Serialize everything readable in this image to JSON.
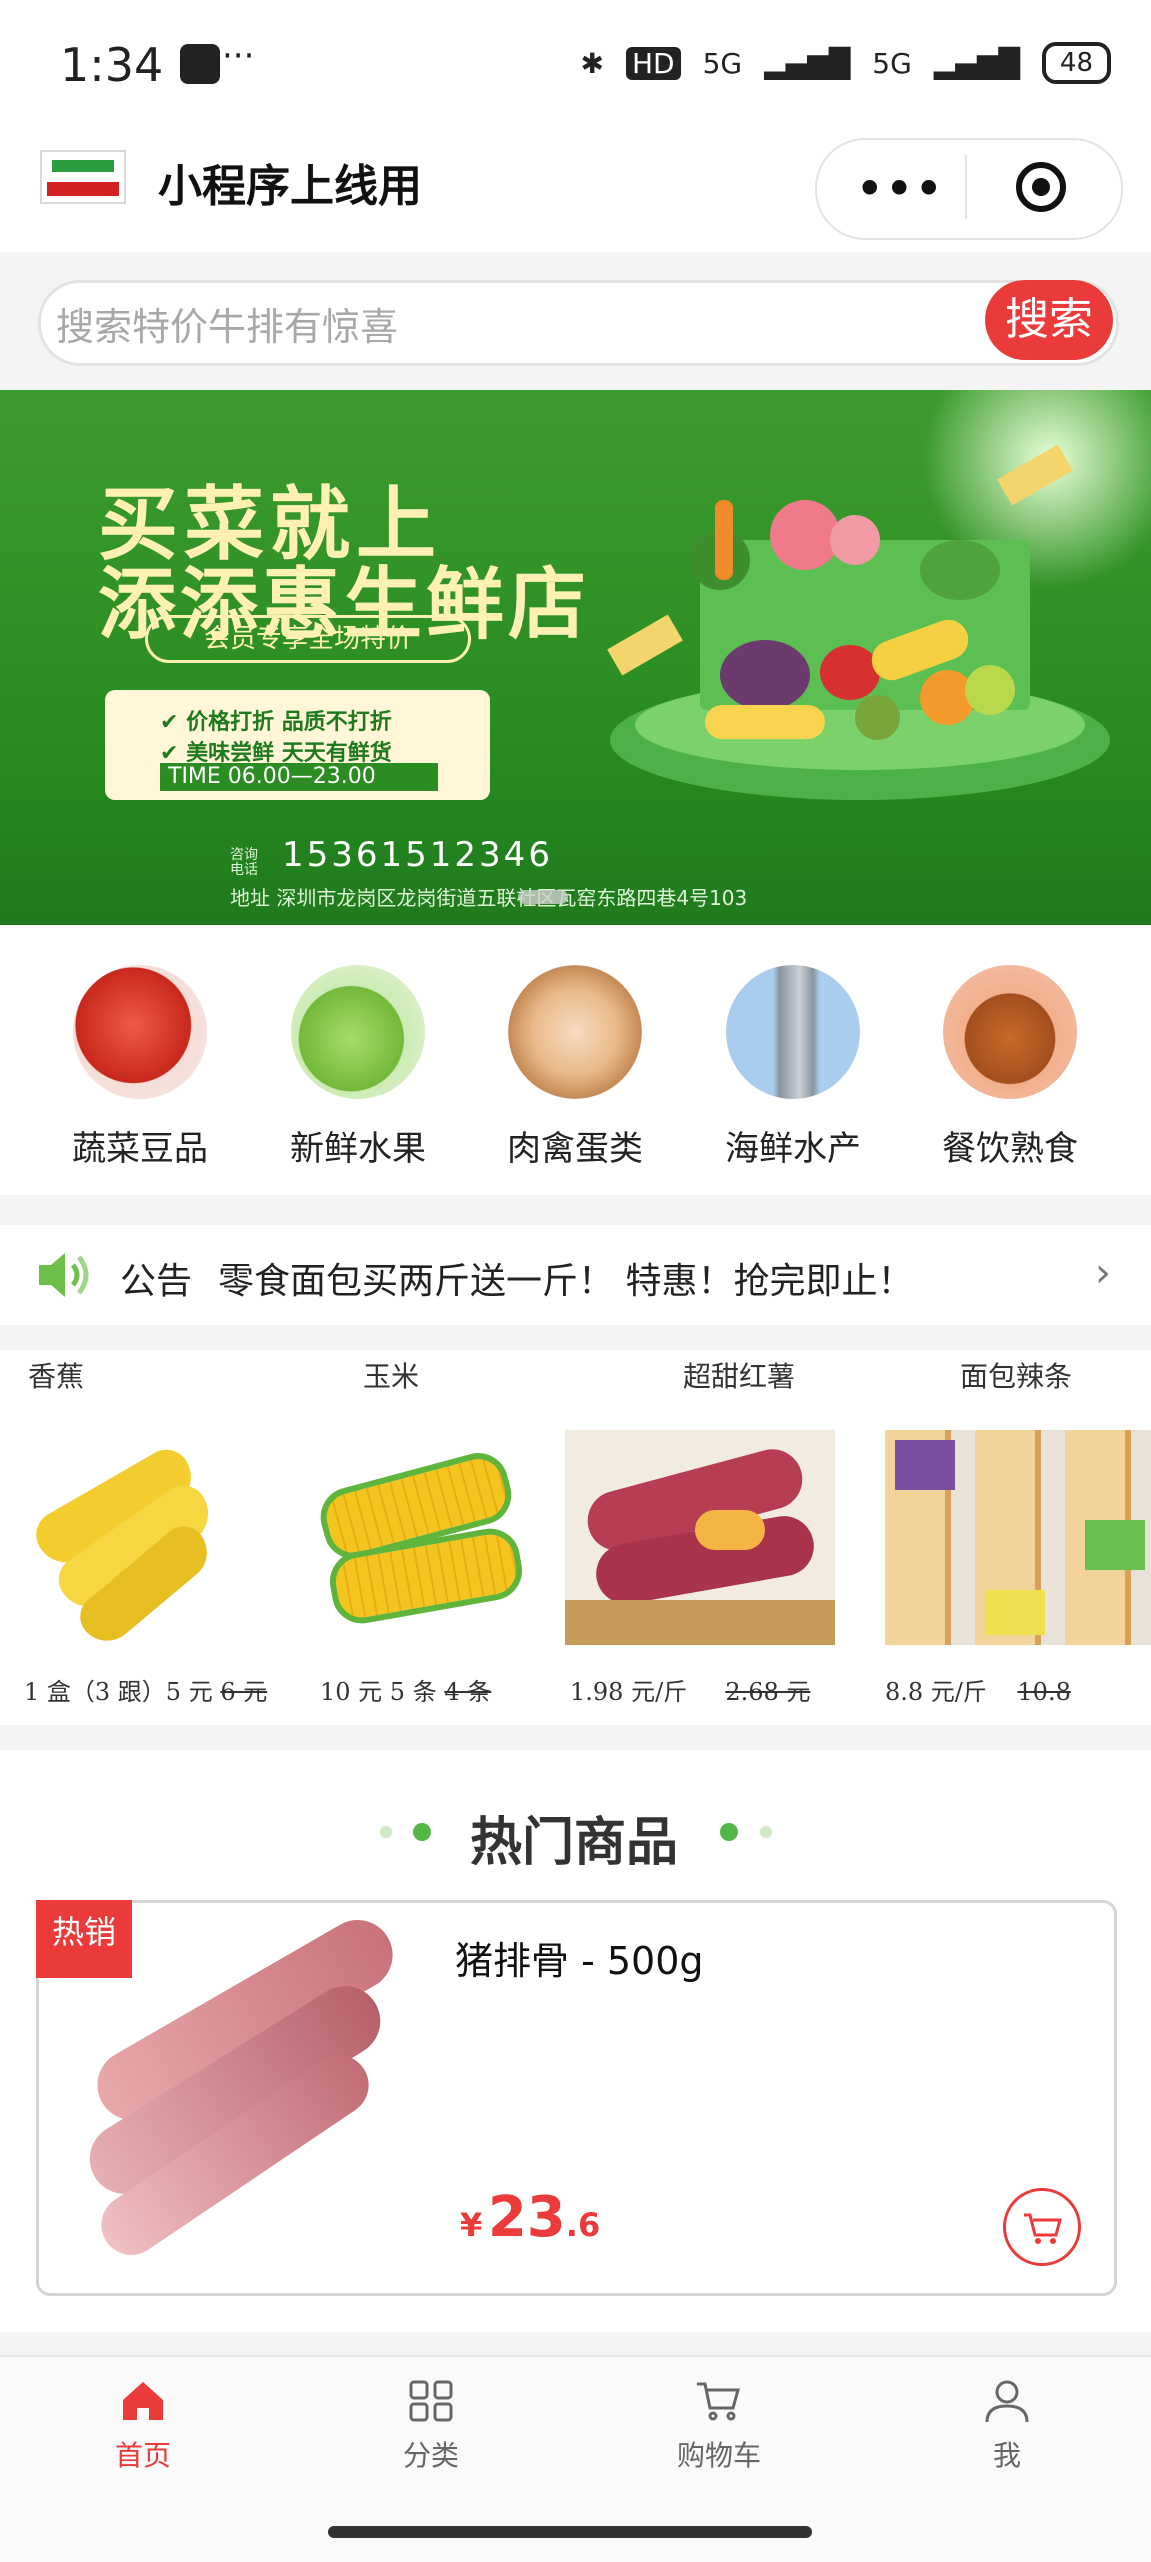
{
  "status_bar": {
    "time": "1:34",
    "dots": "···",
    "hd": "HD",
    "net1": "5G",
    "net2": "5G",
    "battery": "48"
  },
  "nav": {
    "title": "小程序上线用",
    "menu_dots": "•••"
  },
  "search": {
    "placeholder": "搜索特价牛排有惊喜",
    "button": "搜索"
  },
  "banner": {
    "headline_1": "买菜就上",
    "headline_2": "添添惠生鲜店",
    "pill": "会员专享全场特价",
    "line_1": "✔ 价格打折 品质不打折",
    "line_2": "✔ 美味尝鲜 天天有鲜货",
    "time": "TIME   06.00—23.00",
    "phone_label": "咨询\n电话",
    "phone": "15361512346",
    "address": "地址 深圳市龙岗区龙岗街道五联社区瓦窑东路四巷4号103"
  },
  "categories": [
    {
      "label": "蔬菜豆品",
      "icon": "tomato-icon",
      "color": "#e4483a"
    },
    {
      "label": "新鲜水果",
      "icon": "apple-icon",
      "color": "#7dc24b"
    },
    {
      "label": "肉禽蛋类",
      "icon": "egg-icon",
      "color": "#d8a46a"
    },
    {
      "label": "海鲜水产",
      "icon": "fish-icon",
      "color": "#9fc7ea"
    },
    {
      "label": "餐饮熟食",
      "icon": "roast-chicken-icon",
      "color": "#e58b52"
    }
  ],
  "notice": {
    "label": "公告",
    "text": "零食面包买两斤送一斤！ 特惠！抢完即止！"
  },
  "promos": [
    {
      "title": "香蕉",
      "price": "1 盒（3 跟）5 元",
      "old": "6 元"
    },
    {
      "title": "玉米",
      "price": "10 元 5 条",
      "old": "4 条"
    },
    {
      "title": "超甜红薯",
      "price": "1.98 元/斤",
      "old": "2.68 元"
    },
    {
      "title": "面包辣条",
      "price": "8.8 元/斤",
      "old": "10.8"
    }
  ],
  "hot": {
    "title": "热门商品",
    "badge": "热销",
    "product_name": "猪排骨 - 500g",
    "currency": "¥",
    "price_int": "23",
    "price_dec": ".6"
  },
  "tabs": [
    {
      "label": "首页",
      "icon": "home-icon",
      "active": true
    },
    {
      "label": "分类",
      "icon": "category-icon",
      "active": false
    },
    {
      "label": "购物车",
      "icon": "cart-icon",
      "active": false
    },
    {
      "label": "我",
      "icon": "user-icon",
      "active": false
    }
  ],
  "colors": {
    "accent": "#ea3a39",
    "green": "#268a1f"
  }
}
